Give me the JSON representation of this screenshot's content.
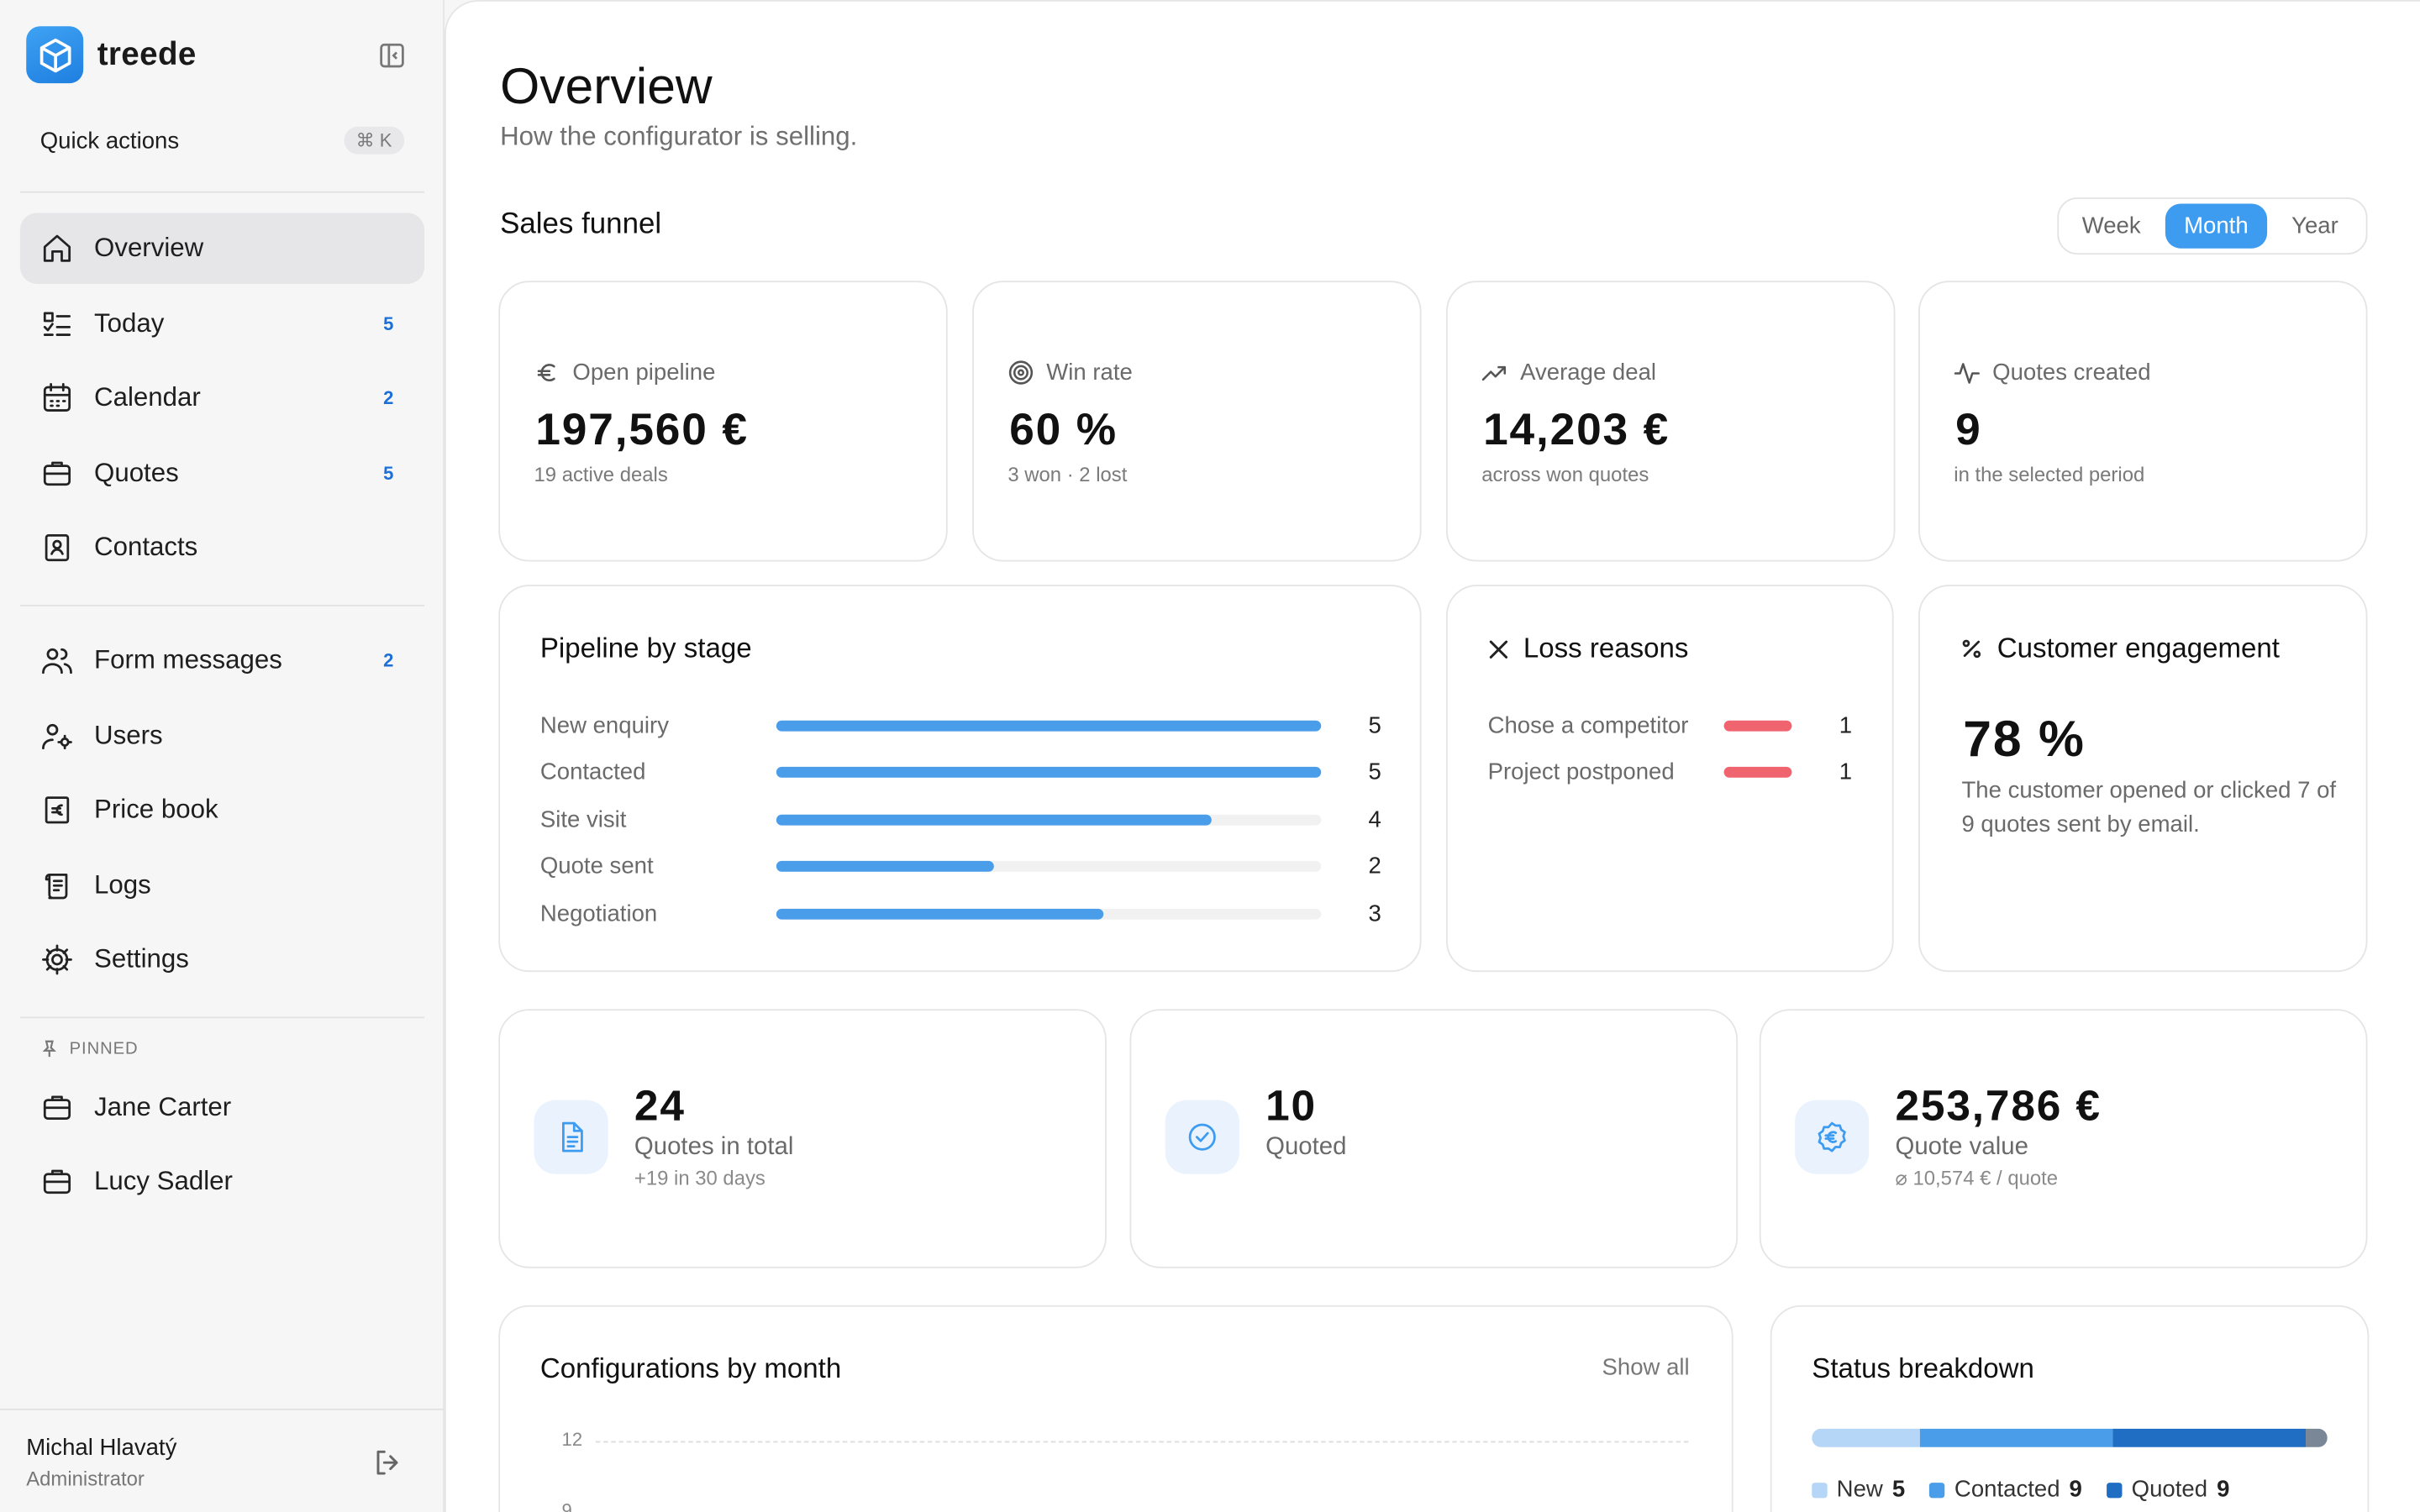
{
  "brand": {
    "name": "treede"
  },
  "sidebar": {
    "quick_actions": {
      "label": "Quick actions",
      "shortcut": "⌘ K"
    },
    "nav": [
      {
        "label": "Overview",
        "icon": "home-icon",
        "active": true,
        "badge": ""
      },
      {
        "label": "Today",
        "icon": "checklist-icon",
        "badge": "5"
      },
      {
        "label": "Calendar",
        "icon": "calendar-icon",
        "badge": "2"
      },
      {
        "label": "Quotes",
        "icon": "briefcase-icon",
        "badge": "5"
      },
      {
        "label": "Contacts",
        "icon": "contact-card-icon",
        "badge": ""
      }
    ],
    "nav2": [
      {
        "label": "Form messages",
        "icon": "people-icon",
        "badge": "2"
      },
      {
        "label": "Users",
        "icon": "user-gear-icon",
        "badge": ""
      },
      {
        "label": "Price book",
        "icon": "price-book-icon",
        "badge": ""
      },
      {
        "label": "Logs",
        "icon": "scroll-icon",
        "badge": ""
      },
      {
        "label": "Settings",
        "icon": "gear-icon",
        "badge": ""
      }
    ],
    "pinned_header": "PINNED",
    "pinned": [
      {
        "label": "Jane Carter",
        "icon": "briefcase-icon"
      },
      {
        "label": "Lucy Sadler",
        "icon": "briefcase-icon"
      }
    ],
    "user": {
      "name": "Michal Hlavatý",
      "role": "Administrator"
    }
  },
  "main": {
    "title": "Overview",
    "subtitle": "How the configurator is selling.",
    "funnel_title": "Sales funnel",
    "periods": [
      {
        "label": "Week",
        "selected": false
      },
      {
        "label": "Month",
        "selected": true
      },
      {
        "label": "Year",
        "selected": false
      }
    ],
    "kpis": [
      {
        "label": "Open pipeline",
        "icon": "euro-icon",
        "value": "197,560 €",
        "sub": "19 active deals"
      },
      {
        "label": "Win rate",
        "icon": "target-icon",
        "value": "60 %",
        "sub": "3 won · 2 lost"
      },
      {
        "label": "Average deal",
        "icon": "trend-up-icon",
        "value": "14,203 €",
        "sub": "across won quotes"
      },
      {
        "label": "Quotes created",
        "icon": "activity-icon",
        "value": "9",
        "sub": "in the selected period"
      }
    ],
    "pipeline": {
      "title": "Pipeline by stage",
      "max": 5,
      "stages": [
        {
          "label": "New enquiry",
          "count": 5
        },
        {
          "label": "Contacted",
          "count": 5
        },
        {
          "label": "Site visit",
          "count": 4
        },
        {
          "label": "Quote sent",
          "count": 2
        },
        {
          "label": "Negotiation",
          "count": 3
        }
      ]
    },
    "loss": {
      "title": "Loss reasons",
      "reasons": [
        {
          "label": "Chose a competitor",
          "count": 1
        },
        {
          "label": "Project postponed",
          "count": 1
        }
      ],
      "bar_color": "#f06470"
    },
    "engagement": {
      "title": "Customer engagement",
      "value": "78 %",
      "text": "The customer opened or clicked 7 of 9 quotes sent by email."
    },
    "stats": [
      {
        "value": "24",
        "label": "Quotes in total",
        "sub": "+19 in 30 days",
        "icon": "document-icon"
      },
      {
        "value": "10",
        "label": "Quoted",
        "sub": "",
        "icon": "check-circle-icon"
      },
      {
        "value": "253,786 €",
        "label": "Quote value",
        "sub": "⌀ 10,574 € / quote",
        "icon": "euro-badge-icon"
      }
    ],
    "configs": {
      "title": "Configurations by month",
      "show_all": "Show all",
      "ticks": [
        "12",
        "9"
      ]
    },
    "status": {
      "title": "Status breakdown",
      "items": [
        {
          "label": "New",
          "count": 5,
          "color": "#b5d6f6"
        },
        {
          "label": "Contacted",
          "count": 9,
          "color": "#4a9de8"
        },
        {
          "label": "Quoted",
          "count": 9,
          "color": "#1f6ec4"
        },
        {
          "label": "",
          "count": 1,
          "color": "#7a8796"
        }
      ]
    },
    "accent": "#3d9bf0"
  }
}
